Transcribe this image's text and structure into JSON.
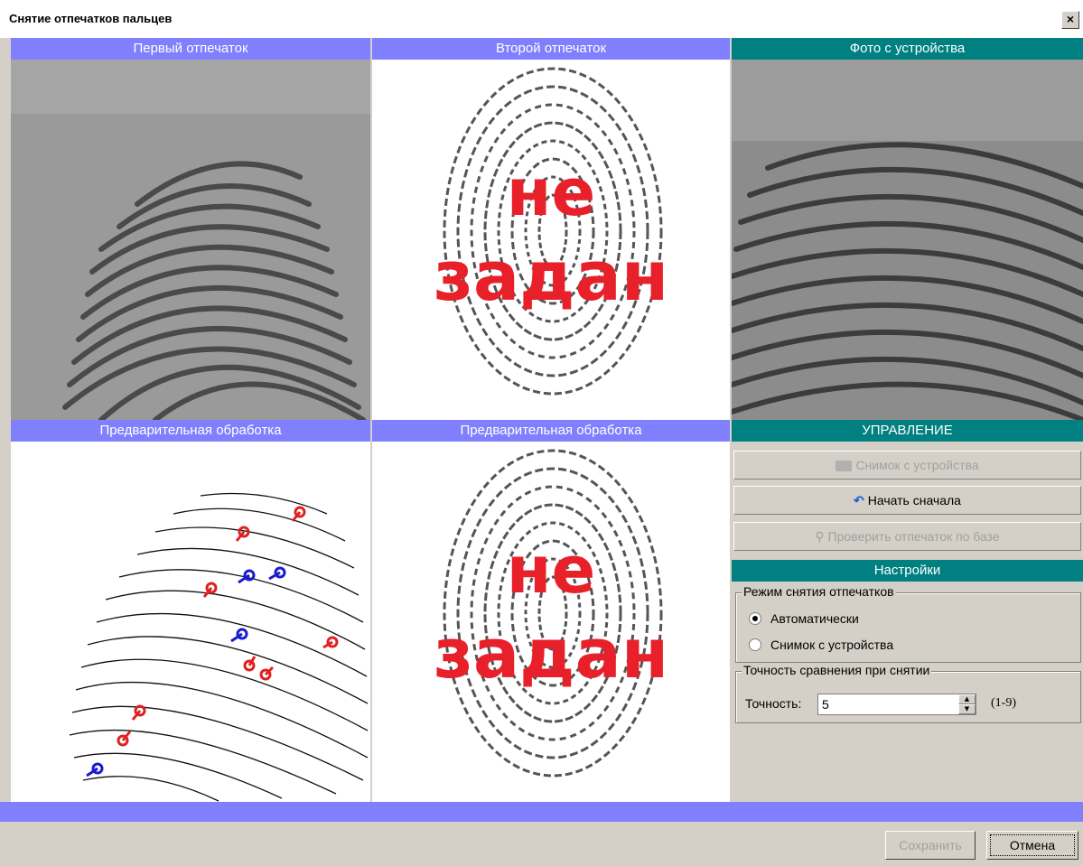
{
  "window": {
    "title": "Снятие отпечатков пальцев",
    "close_label": "×"
  },
  "panels": {
    "first_print": "Первый отпечаток",
    "second_print": "Второй отпечаток",
    "device_photo": "Фото с устройства",
    "preprocess_1": "Предварительная обработка",
    "preprocess_2": "Предварительная обработка",
    "not_set_line1": "не",
    "not_set_line2": "задан"
  },
  "control": {
    "header": "УПРАВЛЕНИЕ",
    "snapshot_button": "Снимок с устройства",
    "restart_button": "Начать сначала",
    "verify_button": "Проверить отпечаток по базе"
  },
  "settings": {
    "header": "Настройки",
    "mode_group": "Режим снятия отпечатков",
    "mode_auto": "Автоматически",
    "mode_snapshot": "Снимок с устройства",
    "mode_selected": "auto",
    "accuracy_group": "Точность сравнения при снятии",
    "accuracy_label": "Точность:",
    "accuracy_value": "5",
    "accuracy_range": "(1-9)"
  },
  "footer": {
    "save_button": "Сохранить",
    "cancel_button": "Отмена"
  },
  "colors": {
    "header_blue": "#8080ff",
    "header_teal": "#008080",
    "warning_red": "#e8202a"
  }
}
